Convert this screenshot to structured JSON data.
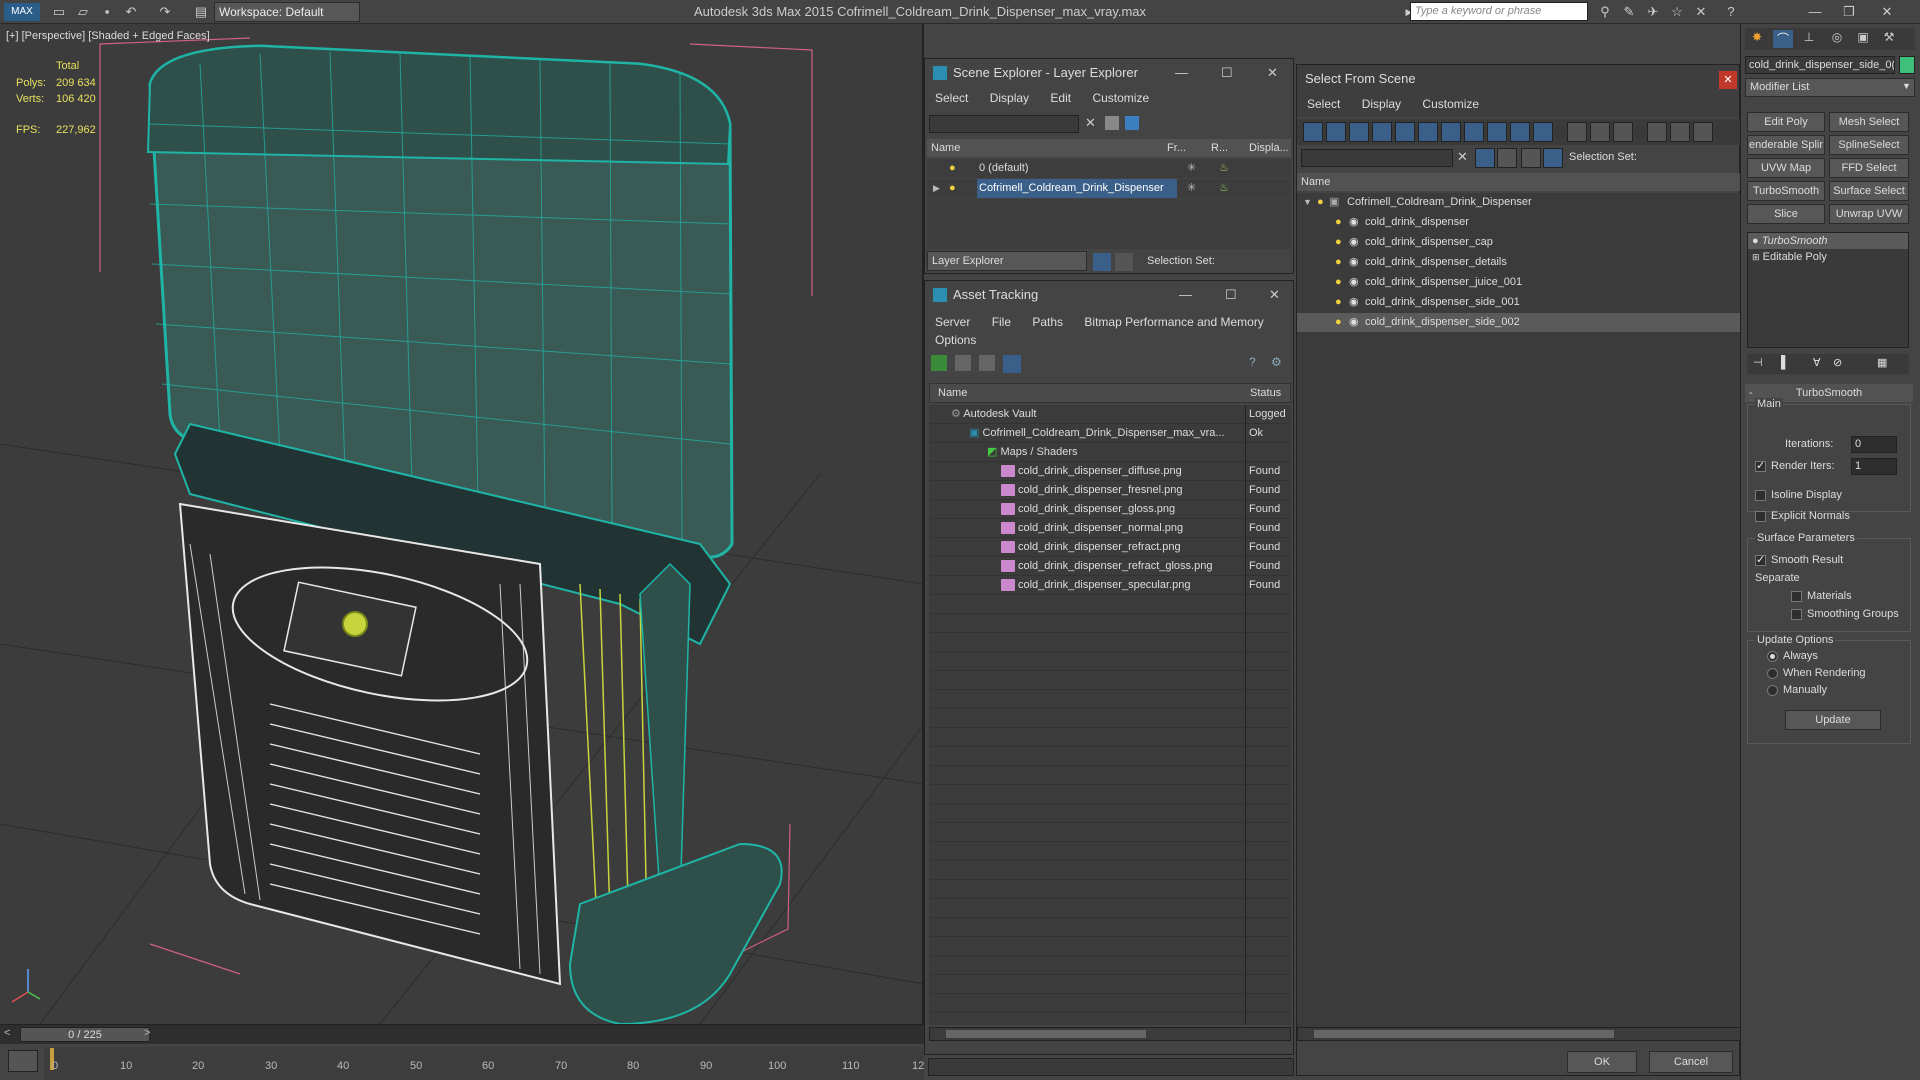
{
  "app": {
    "title": "Autodesk 3ds Max  2015",
    "file": "Cofrimell_Coldream_Drink_Dispenser_max_vray.max",
    "workspace": "Workspace: Default",
    "search_placeholder": "Type a keyword or phrase"
  },
  "viewport": {
    "label": "[+] [Perspective] [Shaded + Edged Faces]",
    "stats": {
      "total_label": "Total",
      "polys_label": "Polys:",
      "polys": "209 634",
      "verts_label": "Verts:",
      "verts": "106 420",
      "fps_label": "FPS:",
      "fps": "227,962"
    }
  },
  "timeline": {
    "slider": "0 / 225",
    "ticks": [
      "0",
      "10",
      "20",
      "30",
      "40",
      "50",
      "60",
      "70",
      "80",
      "90",
      "100",
      "110",
      "12"
    ]
  },
  "scene_explorer": {
    "title": "Scene Explorer - Layer Explorer",
    "menu": [
      "Select",
      "Display",
      "Edit",
      "Customize"
    ],
    "columns": [
      "Name",
      "Fr...",
      "R...",
      "Displa..."
    ],
    "layers": [
      "0 (default)",
      "Cofrimell_Coldream_Drink_Dispenser"
    ],
    "footer_mode": "Layer Explorer",
    "selection_set": "Selection Set:"
  },
  "asset_tracking": {
    "title": "Asset Tracking",
    "menu": [
      "Server",
      "File",
      "Paths",
      "Bitmap Performance and Memory",
      "Options"
    ],
    "columns": [
      "Name",
      "Status"
    ],
    "rows": [
      {
        "name": "Autodesk Vault",
        "status": "Logged"
      },
      {
        "name": "Cofrimell_Coldream_Drink_Dispenser_max_vra...",
        "status": "Ok"
      },
      {
        "name": "Maps / Shaders",
        "status": ""
      },
      {
        "name": "cold_drink_dispenser_diffuse.png",
        "status": "Found"
      },
      {
        "name": "cold_drink_dispenser_fresnel.png",
        "status": "Found"
      },
      {
        "name": "cold_drink_dispenser_gloss.png",
        "status": "Found"
      },
      {
        "name": "cold_drink_dispenser_normal.png",
        "status": "Found"
      },
      {
        "name": "cold_drink_dispenser_refract.png",
        "status": "Found"
      },
      {
        "name": "cold_drink_dispenser_refract_gloss.png",
        "status": "Found"
      },
      {
        "name": "cold_drink_dispenser_specular.png",
        "status": "Found"
      }
    ]
  },
  "select_from_scene": {
    "title": "Select From Scene",
    "menu": [
      "Select",
      "Display",
      "Customize"
    ],
    "selection_set": "Selection Set:",
    "column": "Name",
    "root": "Cofrimell_Coldream_Drink_Dispenser",
    "objects": [
      "cold_drink_dispenser",
      "cold_drink_dispenser_cap",
      "cold_drink_dispenser_details",
      "cold_drink_dispenser_juice_001",
      "cold_drink_dispenser_side_001",
      "cold_drink_dispenser_side_002"
    ],
    "ok": "OK",
    "cancel": "Cancel"
  },
  "command_panel": {
    "object_name": "cold_drink_dispenser_side_0(",
    "modifier_list": "Modifier List",
    "buttons": [
      "Edit Poly",
      "Mesh Select",
      "enderable Splir",
      "SplineSelect",
      "UVW Map",
      "FFD Select",
      "TurboSmooth",
      "Surface Select",
      "Slice",
      "Unwrap UVW"
    ],
    "stack": [
      "TurboSmooth",
      "Editable Poly"
    ],
    "rollout": {
      "title": "TurboSmooth",
      "main": "Main",
      "iterations_label": "Iterations:",
      "iterations": "0",
      "render_iters_label": "Render Iters:",
      "render_iters": "1",
      "isoline": "Isoline Display",
      "explicit": "Explicit Normals",
      "surface_params": "Surface Parameters",
      "smooth_result": "Smooth Result",
      "separate": "Separate",
      "materials": "Materials",
      "smoothing_groups": "Smoothing Groups",
      "update_options": "Update Options",
      "always": "Always",
      "when_rendering": "When Rendering",
      "manually": "Manually",
      "update": "Update"
    }
  },
  "colors": {
    "wire_teal": "#1fb5a6",
    "wire_white": "#e8e8e8",
    "wire_yellow": "#c8d43c",
    "selection": "#3a5f88"
  }
}
